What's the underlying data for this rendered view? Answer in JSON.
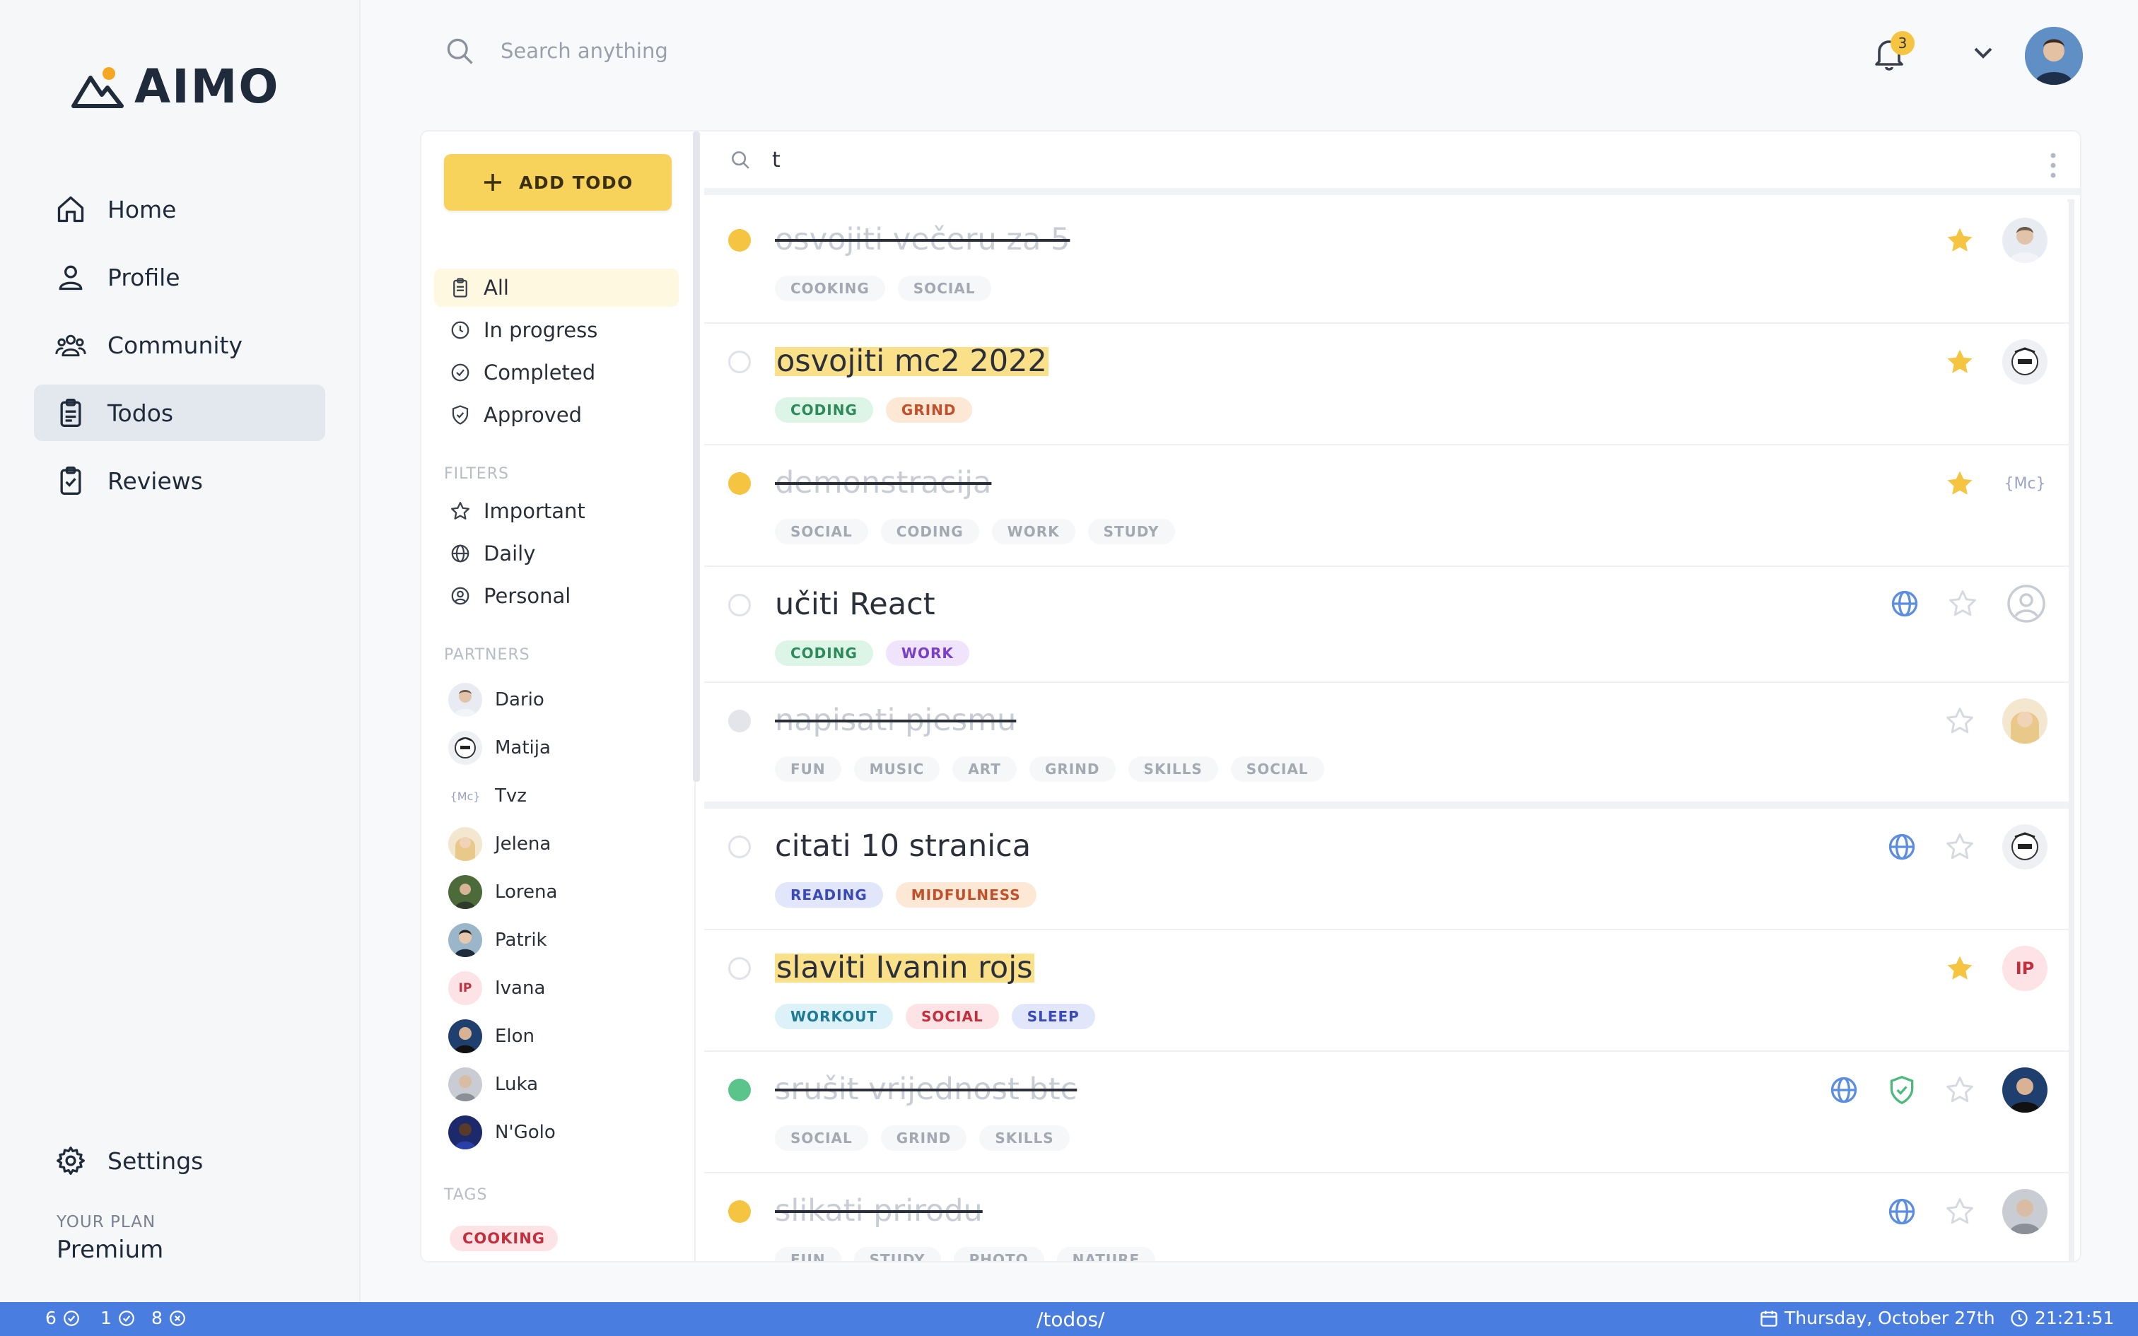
{
  "app": {
    "brand": "AIMO"
  },
  "colors": {
    "accent": "#f7d35c",
    "statusbar": "#4a7de0",
    "nav_active": "#e3e7ee"
  },
  "nav": [
    {
      "label": "Home",
      "icon": "home-icon"
    },
    {
      "label": "Profile",
      "icon": "user-icon"
    },
    {
      "label": "Community",
      "icon": "community-icon"
    },
    {
      "label": "Todos",
      "icon": "clipboard-icon",
      "active": true
    },
    {
      "label": "Reviews",
      "icon": "clipboard-check-icon"
    }
  ],
  "settings": {
    "label": "Settings"
  },
  "plan": {
    "label": "YOUR PLAN",
    "value": "Premium"
  },
  "topbar": {
    "search_placeholder": "Search anything",
    "notification_count": "3"
  },
  "filters": {
    "add_label": "ADD TODO",
    "views": [
      {
        "label": "All",
        "icon": "clipboard-icon",
        "active": true
      },
      {
        "label": "In progress",
        "icon": "clock-icon"
      },
      {
        "label": "Completed",
        "icon": "check-circle-icon"
      },
      {
        "label": "Approved",
        "icon": "shield-check-icon"
      }
    ],
    "filters_title": "FILTERS",
    "filter_items": [
      {
        "label": "Important",
        "icon": "star-icon"
      },
      {
        "label": "Daily",
        "icon": "globe-icon"
      },
      {
        "label": "Personal",
        "icon": "user-circle-icon"
      }
    ],
    "partners_title": "PARTNERS",
    "partners": [
      "Dario",
      "Matija",
      "Tvz",
      "Jelena",
      "Lorena",
      "Patrik",
      "Ivana",
      "Elon",
      "Luka",
      "N'Golo"
    ],
    "tags_title": "TAGS",
    "tags": [
      "COOKING"
    ]
  },
  "list": {
    "search_value": "t",
    "todos": [
      {
        "title": "osvojiti večeru za 5",
        "done": true,
        "status": "yellow",
        "tags": [
          "COOKING",
          "SOCIAL"
        ],
        "starred": true
      },
      {
        "title": "osvojiti mc2 2022",
        "done": false,
        "highlight": true,
        "tags": [
          "CODING",
          "GRIND"
        ],
        "starred": true
      },
      {
        "title": "demonstracija",
        "done": true,
        "status": "yellow",
        "tags": [
          "SOCIAL",
          "CODING",
          "WORK",
          "STUDY"
        ],
        "starred": true,
        "avatar_text": "{Mc}"
      },
      {
        "title": "učiti React",
        "done": false,
        "tags": [
          "CODING",
          "WORK"
        ],
        "starred": false,
        "daily": true
      },
      {
        "title": "napisati pjesmu",
        "done": true,
        "status": "grey",
        "tags": [
          "FUN",
          "MUSIC",
          "ART",
          "GRIND",
          "SKILLS",
          "SOCIAL"
        ],
        "starred": false
      },
      {
        "title": "citati 10 stranica",
        "done": false,
        "tags": [
          "READING",
          "MIDFULNESS"
        ],
        "starred": false,
        "daily": true
      },
      {
        "title": "slaviti Ivanin rojs",
        "done": false,
        "highlight": true,
        "tags": [
          "WORKOUT",
          "SOCIAL",
          "SLEEP"
        ],
        "starred": true,
        "avatar_text": "IP"
      },
      {
        "title": "srušit vrijednost btc",
        "done": true,
        "status": "green",
        "tags": [
          "SOCIAL",
          "GRIND",
          "SKILLS"
        ],
        "starred": false,
        "daily": true,
        "approved": true
      },
      {
        "title": "slikati prirodu",
        "done": true,
        "status": "yellow",
        "tags": [
          "FUN",
          "STUDY",
          "PHOTO",
          "NATURE"
        ],
        "starred": false,
        "daily": true
      }
    ]
  },
  "statusbar": {
    "in_progress": "6",
    "completed": "1",
    "failed": "8",
    "route": "/todos/",
    "date": "Thursday, October 27th",
    "time": "21:21:51"
  }
}
